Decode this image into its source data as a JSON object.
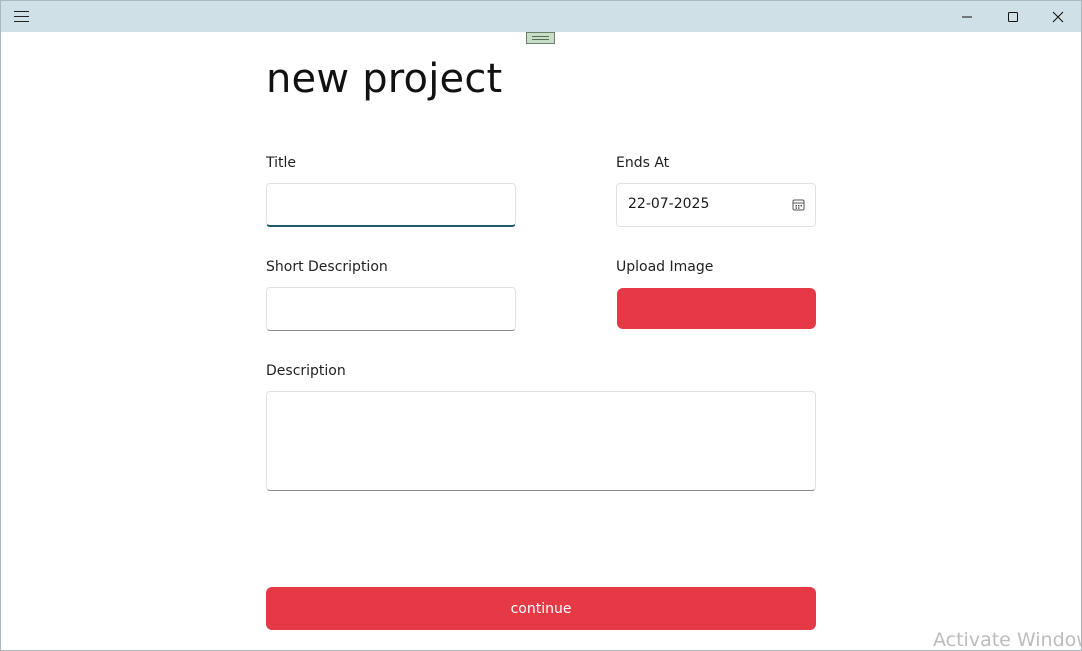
{
  "page": {
    "title": "new project"
  },
  "form": {
    "title_label": "Title",
    "title_value": "",
    "ends_at_label": "Ends At",
    "ends_at_value": "22-07-2025",
    "short_description_label": "Short Description",
    "short_description_value": "",
    "upload_image_label": "Upload Image",
    "description_label": "Description",
    "description_value": "",
    "continue_label": "continue"
  },
  "watermark": {
    "text": "Activate Window"
  },
  "icons": {
    "menu": "hamburger-menu-icon",
    "minimize": "minimize-icon",
    "maximize": "maximize-icon",
    "close": "close-icon",
    "calendar": "calendar-icon"
  },
  "colors": {
    "titlebar": "#cfe0e7",
    "accent_red": "#e63946",
    "focus_underline": "#1d5a66"
  }
}
